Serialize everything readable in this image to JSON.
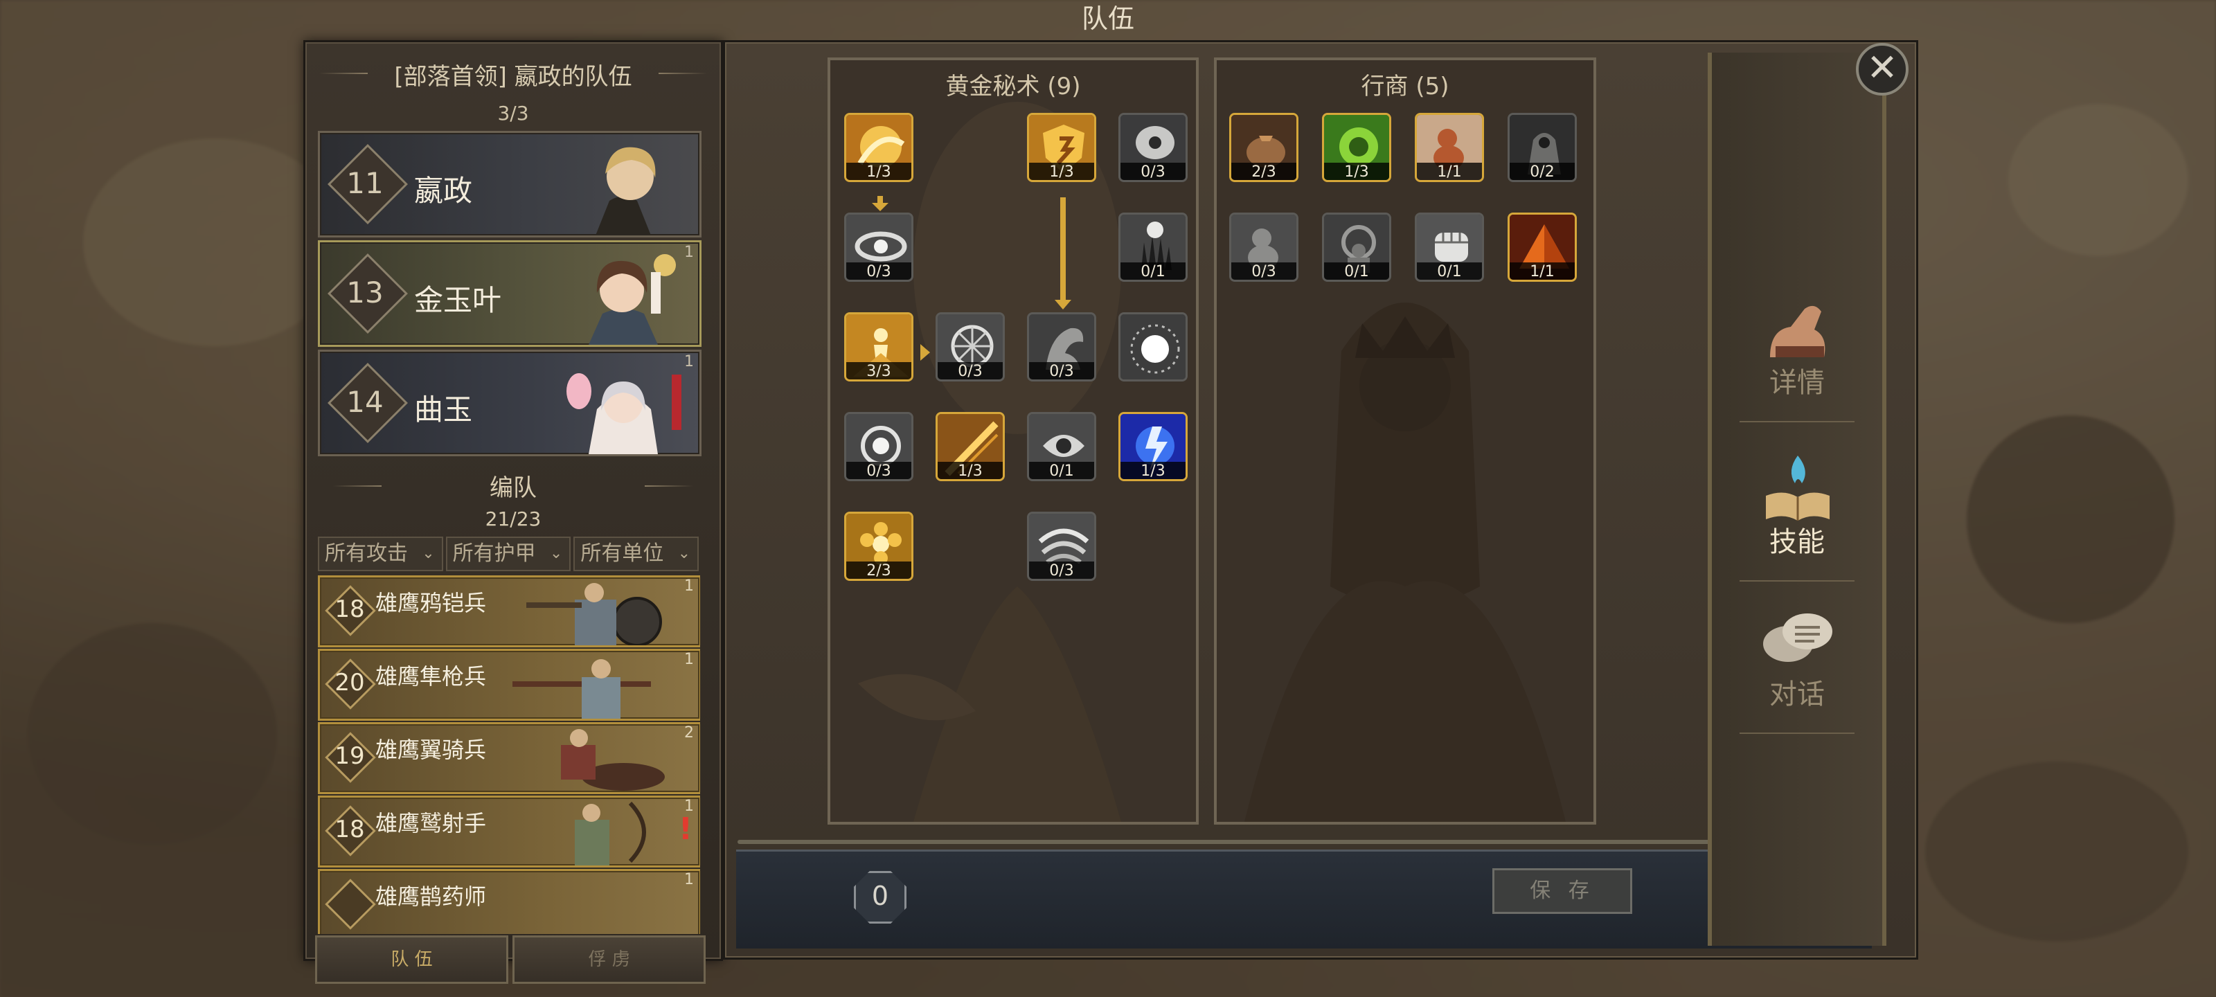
{
  "window_title": "队伍",
  "left_panel": {
    "title": "[部落首领] 嬴政的队伍",
    "hero_count": "3/3",
    "heroes": [
      {
        "level": "11",
        "name": "嬴政",
        "badge": ""
      },
      {
        "level": "13",
        "name": "金玉叶",
        "badge": "1"
      },
      {
        "level": "14",
        "name": "曲玉",
        "badge": "1"
      }
    ],
    "formation_title": "编队",
    "formation_count": "21/23",
    "filters": [
      "所有攻击",
      "所有护甲",
      "所有单位"
    ],
    "units": [
      {
        "level": "18",
        "name": "雄鹰鸦铠兵",
        "badge": "1"
      },
      {
        "level": "20",
        "name": "雄鹰隼枪兵",
        "badge": "1"
      },
      {
        "level": "19",
        "name": "雄鹰翼骑兵",
        "badge": "2"
      },
      {
        "level": "18",
        "name": "雄鹰鹫射手",
        "badge": "1",
        "warning": "!"
      },
      {
        "level": "",
        "name": "雄鹰鹊药师",
        "badge": "1"
      }
    ],
    "tabs": [
      "队 伍",
      "俘 虏"
    ]
  },
  "skill_trees": {
    "golden": {
      "title": "黄金秘术 (9)",
      "skills": [
        {
          "icon": "golden-swirl-icon",
          "level": "1/3",
          "style": "gold"
        },
        {
          "icon": "golden-shield-rune-icon",
          "level": "1/3",
          "style": "gold"
        },
        {
          "icon": "arcane-eye-icon",
          "level": "0/3",
          "style": "grey"
        },
        {
          "icon": "spiral-orb-icon",
          "level": "0/3",
          "style": "grey"
        },
        {
          "icon": "claw-hand-icon",
          "level": "0/1",
          "style": "grey"
        },
        {
          "icon": "golden-figure-icon",
          "level": "3/3",
          "style": "gold"
        },
        {
          "icon": "radiant-wheel-icon",
          "level": "0/3",
          "style": "grey"
        },
        {
          "icon": "ghost-hand-icon",
          "level": "0/3",
          "style": "grey"
        },
        {
          "icon": "light-burst-icon",
          "level": "",
          "style": "grey"
        },
        {
          "icon": "orb-spin-icon",
          "level": "0/3",
          "style": "grey"
        },
        {
          "icon": "golden-strike-icon",
          "level": "1/3",
          "style": "gold"
        },
        {
          "icon": "mechanical-eye-icon",
          "level": "0/1",
          "style": "grey"
        },
        {
          "icon": "blue-lightning-icon",
          "level": "1/3",
          "style": "gold"
        },
        {
          "icon": "golden-bloom-icon",
          "level": "2/3",
          "style": "gold"
        },
        {
          "icon": "whirlwind-icon",
          "level": "0/3",
          "style": "grey"
        }
      ]
    },
    "merchant": {
      "title": "行商 (5)",
      "skills": [
        {
          "icon": "coin-bag-icon",
          "level": "2/3",
          "style": "gold"
        },
        {
          "icon": "green-coin-icon",
          "level": "1/3",
          "style": "gold"
        },
        {
          "icon": "gourd-icon",
          "level": "1/1",
          "style": "gold"
        },
        {
          "icon": "hooded-figure-icon",
          "level": "0/2",
          "style": "grey"
        },
        {
          "icon": "grey-gourd-icon",
          "level": "0/3",
          "style": "grey"
        },
        {
          "icon": "crowd-icon",
          "level": "0/1",
          "style": "grey"
        },
        {
          "icon": "fist-icon",
          "level": "0/1",
          "style": "grey"
        },
        {
          "icon": "fire-pyramid-icon",
          "level": "1/1",
          "style": "gold"
        }
      ]
    }
  },
  "skill_points": "0",
  "save_label": "保 存",
  "nav": [
    {
      "label": "详情",
      "icon": "flexed-arm-icon"
    },
    {
      "label": "技能",
      "icon": "flaming-book-icon"
    },
    {
      "label": "对话",
      "icon": "speech-bubbles-icon"
    }
  ],
  "close_label": "✕",
  "colors": {
    "gold": "#d6a73a",
    "panel": "#3a3128",
    "accent_text": "#f1e6cd"
  }
}
